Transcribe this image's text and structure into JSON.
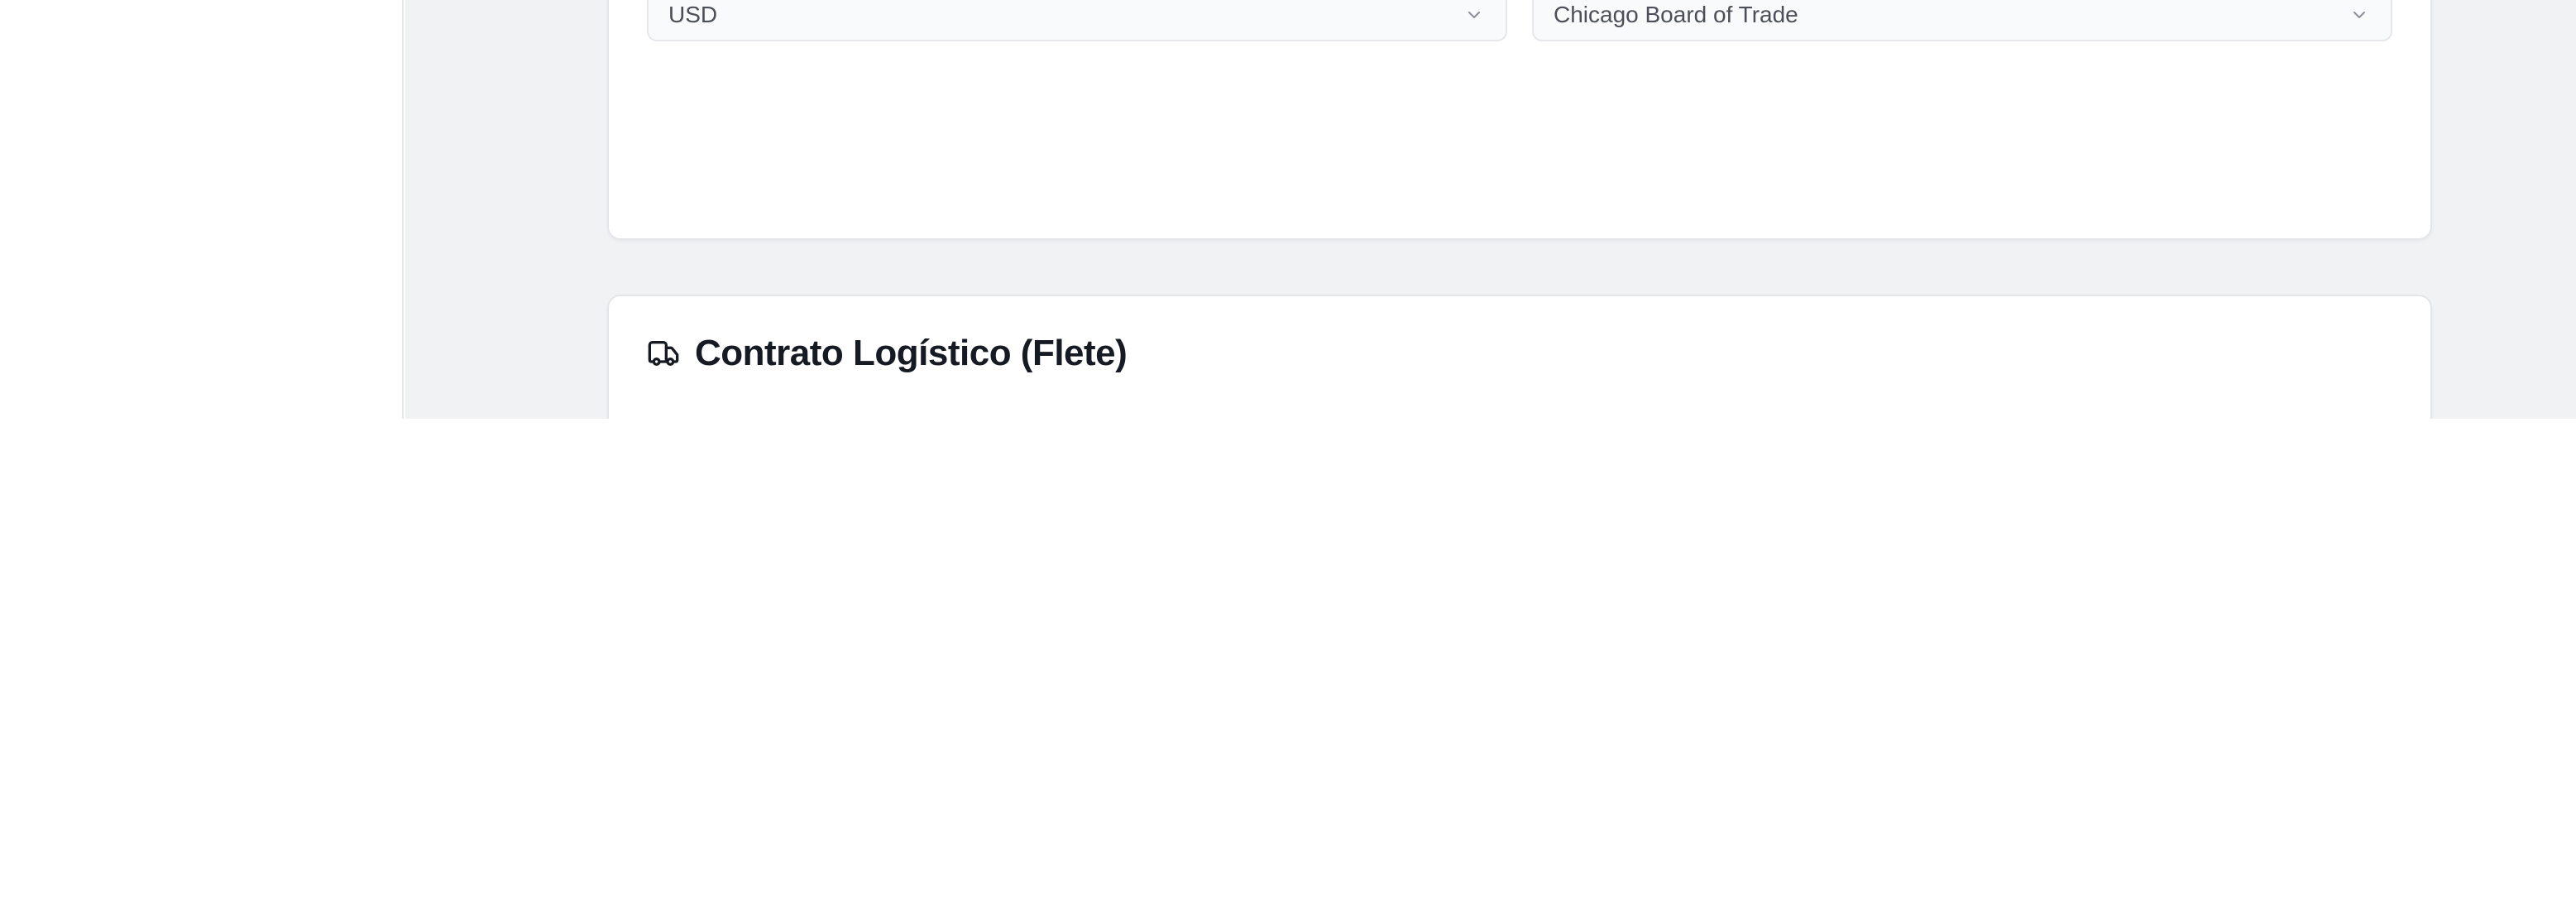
{
  "form": {
    "currency": {
      "selected": "USD"
    },
    "exchange": {
      "selected": "Chicago Board of Trade"
    }
  },
  "logistics_section": {
    "title": "Contrato Logístico (Flete)",
    "icon": "truck-icon"
  },
  "colors": {
    "page_background": "#f1f2f4",
    "card_background": "#ffffff",
    "select_background": "#f9fafb",
    "border": "#e4e5e8",
    "title_text": "#151a23",
    "select_text": "#4b5058"
  }
}
